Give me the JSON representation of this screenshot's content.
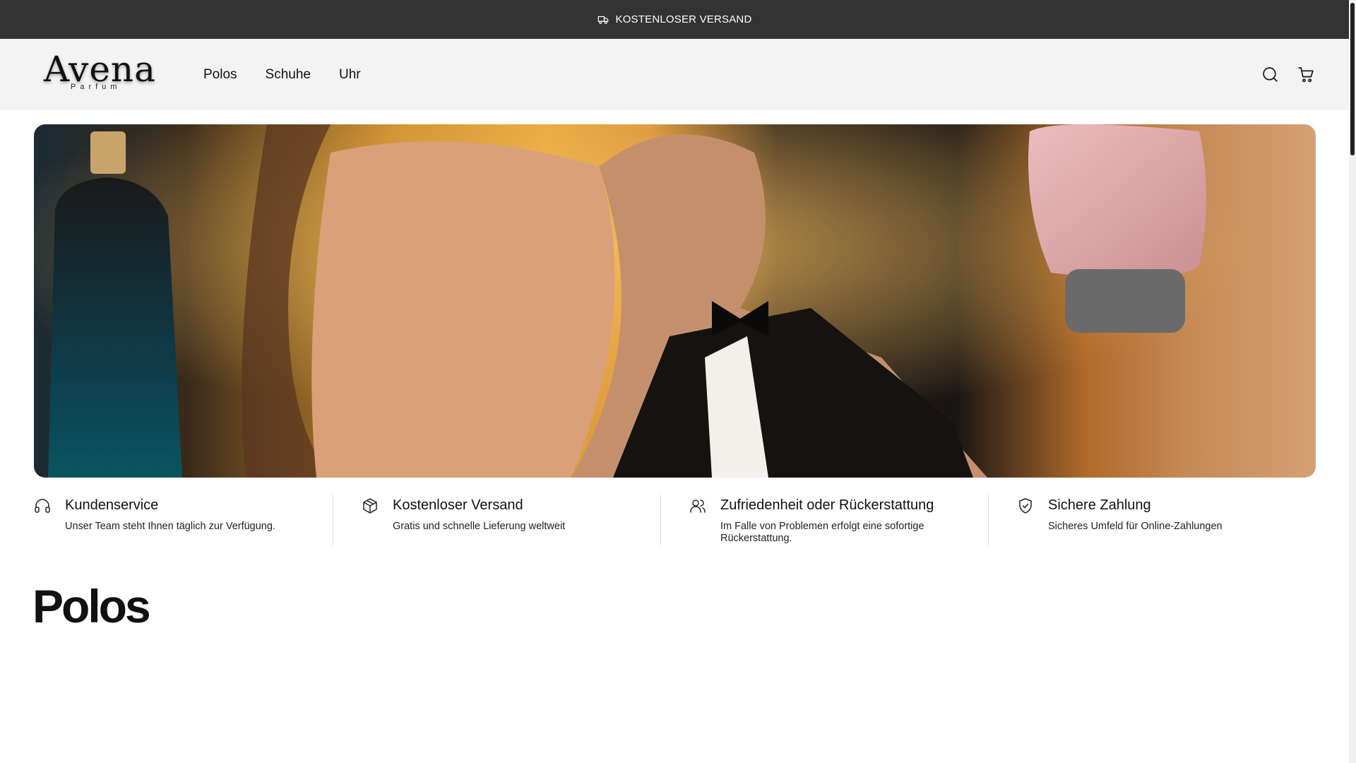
{
  "announcement": {
    "text": "KOSTENLOSER VERSAND",
    "icon": "truck-icon"
  },
  "header": {
    "logo": {
      "main": "Avena",
      "sub": "Parfum"
    },
    "nav": [
      {
        "label": "Polos"
      },
      {
        "label": "Schuhe"
      },
      {
        "label": "Uhr"
      }
    ],
    "icons": [
      "search-icon",
      "cart-icon"
    ]
  },
  "hero": {
    "alt": ""
  },
  "features": [
    {
      "icon": "headphones-icon",
      "title": "Kundenservice",
      "text": "Unser Team steht Ihnen täglich zur Verfügung."
    },
    {
      "icon": "package-icon",
      "title": "Kostenloser Versand",
      "text": "Gratis und schnelle Lieferung weltweit"
    },
    {
      "icon": "users-icon",
      "title": "Zufriedenheit oder Rückerstattung",
      "text": "Im Falle von Problemen erfolgt eine sofortige Rückerstattung."
    },
    {
      "icon": "shield-check-icon",
      "title": "Sichere Zahlung",
      "text": "Sicheres Umfeld für Online-Zahlungen"
    }
  ],
  "section": {
    "title": "Polos"
  },
  "colors": {
    "announce_bg": "#333333",
    "header_bg": "#f3f3f3",
    "text": "#111111"
  }
}
